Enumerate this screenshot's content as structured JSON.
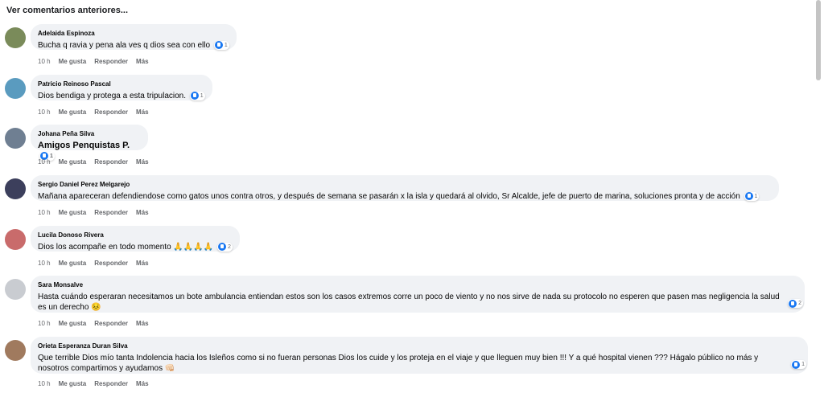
{
  "view_more_label": "Ver comentarios anteriores...",
  "action_labels": {
    "like": "Me gusta",
    "reply": "Responder",
    "more": "Más"
  },
  "comments": [
    {
      "name": "Adelaida Espinoza",
      "text": "Bucha q ravia y pena ala ves q dios sea con ello",
      "time": "10 h",
      "reactions": "1",
      "avatar_color": "#7a8b5a"
    },
    {
      "name": "Patricio Reinoso Pascal",
      "text": "Dios bendiga y protega a esta tripulacion.",
      "time": "10 h",
      "reactions": "1",
      "avatar_color": "#5a9bbf"
    },
    {
      "name": "Johana Peña Silva",
      "text": "Amigos Penquistas P.",
      "time": "10 h",
      "reactions": "1",
      "avatar_color": "#6f7f92"
    },
    {
      "name": "Sergio Daniel Perez Melgarejo",
      "text": "Mañana apareceran defendiendose como gatos unos contra otros, y después de semana se pasarán x la isla y quedará al olvido, Sr Alcalde, jefe de puerto de marina, soluciones pronta y de acción",
      "time": "10 h",
      "reactions": "1",
      "avatar_color": "#3c3f5c"
    },
    {
      "name": "Lucila Donoso Rivera",
      "text": "Dios los acompañe en todo momento 🙏🙏🙏🙏",
      "time": "10 h",
      "reactions": "2",
      "avatar_color": "#c96b6b"
    },
    {
      "name": "Sara Monsalve",
      "text": "Hasta cuándo esperaran necesitamos un bote ambulancia entiendan estos son los casos extremos corre un poco de viento y no nos sirve de nada su protocolo no esperen que pasen mas negligencia la salud es un derecho 😣",
      "time": "10 h",
      "reactions": "2",
      "avatar_color": "#c9ccd1"
    },
    {
      "name": "Orieta Esperanza Duran Silva",
      "text": "Que terrible Dios mío tanta Indolencia hacia los Isleños como si no fueran personas Dios los cuide y los proteja en el viaje y que lleguen muy bien !!! Y a qué hospital vienen ??? Hágalo público no más y nosotros compartimos y ayudamos 👊🏻",
      "time": "10 h",
      "reactions": "1",
      "avatar_color": "#a07a5e"
    }
  ]
}
